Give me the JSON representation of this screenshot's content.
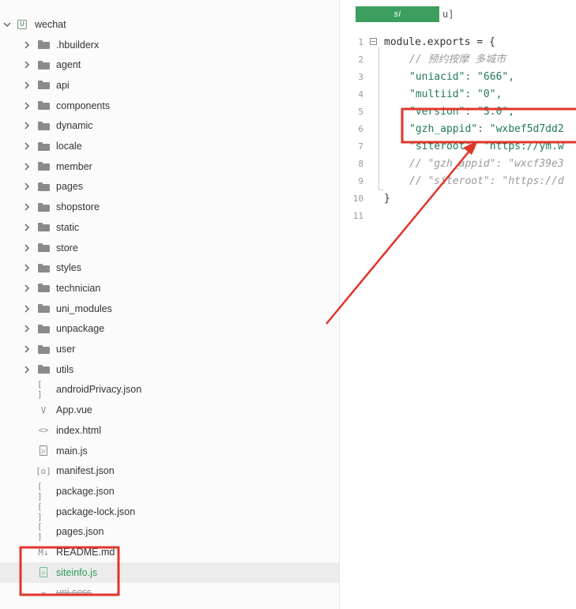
{
  "sidebar": {
    "root": {
      "label": "wechat",
      "icon": "project-icon"
    },
    "folders": [
      ".hbuilderx",
      "agent",
      "api",
      "components",
      "dynamic",
      "locale",
      "member",
      "pages",
      "shopstore",
      "static",
      "store",
      "styles",
      "technician",
      "uni_modules",
      "unpackage",
      "user",
      "utils"
    ],
    "files": [
      {
        "name": "androidPrivacy.json",
        "icon": "json-icon",
        "glyph": "[ ]"
      },
      {
        "name": "App.vue",
        "icon": "vue-file-icon",
        "glyph": "V"
      },
      {
        "name": "index.html",
        "icon": "html-icon",
        "glyph": "<>"
      },
      {
        "name": "main.js",
        "icon": "js-file-icon",
        "glyph": "js"
      },
      {
        "name": "manifest.json",
        "icon": "manifest-icon",
        "glyph": "[o]"
      },
      {
        "name": "package.json",
        "icon": "json-icon",
        "glyph": "[ ]"
      },
      {
        "name": "package-lock.json",
        "icon": "json-icon",
        "glyph": "[ ]"
      },
      {
        "name": "pages.json",
        "icon": "json-icon",
        "glyph": "[ ]"
      },
      {
        "name": "README.md",
        "icon": "markdown-icon",
        "glyph": "M↓"
      },
      {
        "name": "siteinfo.js",
        "icon": "js-file-icon",
        "glyph": "js",
        "selected": true
      },
      {
        "name": "uni.scss",
        "icon": "scss-icon",
        "glyph": "~"
      }
    ]
  },
  "editor": {
    "tab": {
      "label": "si",
      "suffix": "u]"
    },
    "lines": [
      {
        "n": "1",
        "text": "module.exports = {",
        "kind": "plain",
        "fold": true
      },
      {
        "n": "2",
        "text": "// 预约按摩 多城市",
        "kind": "comment"
      },
      {
        "n": "3",
        "text": "\"uniacid\": \"666\",",
        "kind": "str"
      },
      {
        "n": "4",
        "text": "\"multiid\": \"0\",",
        "kind": "str"
      },
      {
        "n": "5",
        "text": "\"version\": \"3.0\",",
        "kind": "str"
      },
      {
        "n": "6",
        "text": "\"gzh_appid\": \"wxbef5d7dd2",
        "kind": "str"
      },
      {
        "n": "7",
        "text": "\"siteroot\": \"https://ym.w",
        "kind": "str"
      },
      {
        "n": "8",
        "text": "// \"gzh_appid\": \"wxcf39e3",
        "kind": "comment"
      },
      {
        "n": "9",
        "text": "// \"siteroot\": \"https://d",
        "kind": "comment"
      },
      {
        "n": "10",
        "text": "}",
        "kind": "plain"
      },
      {
        "n": "11",
        "text": "",
        "kind": "plain"
      }
    ]
  },
  "colors": {
    "annotation_red": "#e0352b",
    "tab_green": "#3c9e5f",
    "string_green": "#217a58",
    "comment_gray": "#9a9a9a"
  }
}
